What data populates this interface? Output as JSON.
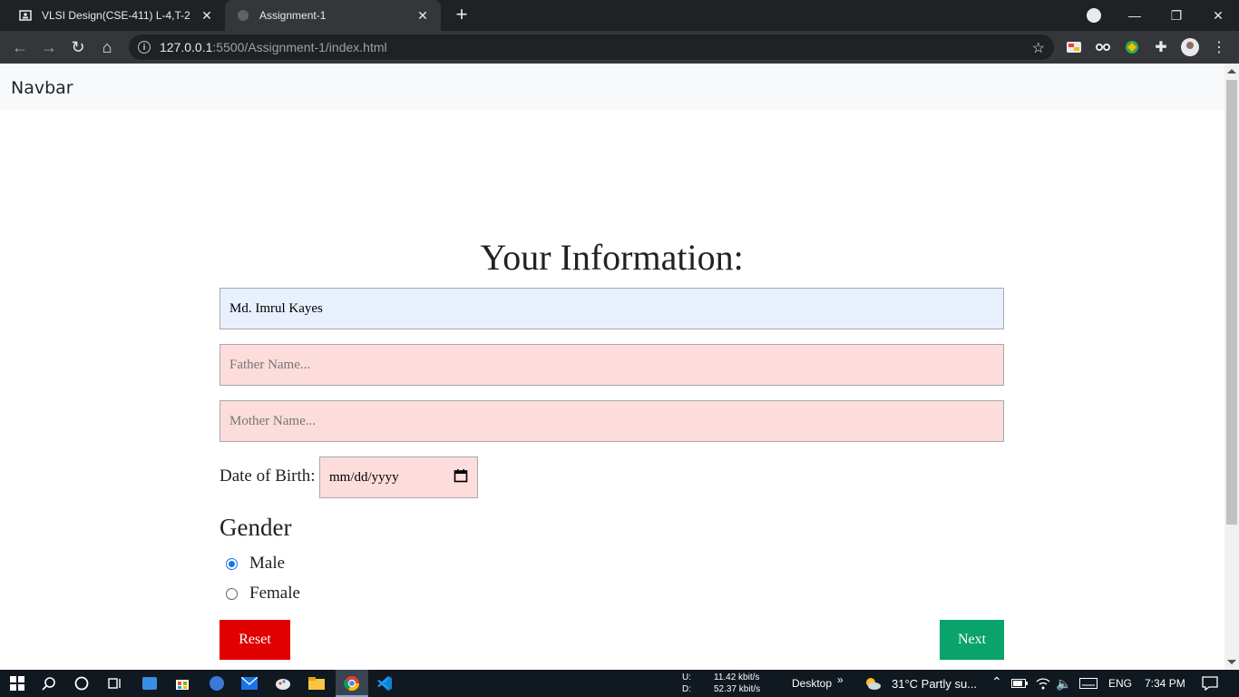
{
  "browser": {
    "tabs": [
      {
        "title": "VLSI Design(CSE-411) L-4,T-2",
        "active": false
      },
      {
        "title": "Assignment-1",
        "active": true
      }
    ],
    "url_host": "127.0.0.1",
    "url_rest": ":5500/Assignment-1/index.html"
  },
  "navbar": {
    "brand": "Navbar"
  },
  "form": {
    "title": "Your Information:",
    "name_value": "Md. Imrul Kayes",
    "father_placeholder": "Father Name...",
    "mother_placeholder": "Mother Name...",
    "dob_label": "Date of Birth:",
    "dob_value": "mm/dd/yyyy",
    "gender_title": "Gender",
    "gender_options": [
      {
        "label": "Male",
        "selected": true
      },
      {
        "label": "Female",
        "selected": false
      }
    ],
    "reset_label": "Reset",
    "next_label": "Next"
  },
  "taskbar": {
    "net_up_label": "U:",
    "net_up": "11.42 kbit/s",
    "net_down_label": "D:",
    "net_down": "52.37 kbit/s",
    "desktop": "Desktop",
    "weather": "31°C  Partly su...",
    "lang": "ENG",
    "time": "7:34 PM"
  },
  "colors": {
    "reset": "#e00000",
    "next": "#0aa36c",
    "input_invalid": "#fddcdc",
    "input_autofill": "#e8f0fe"
  }
}
